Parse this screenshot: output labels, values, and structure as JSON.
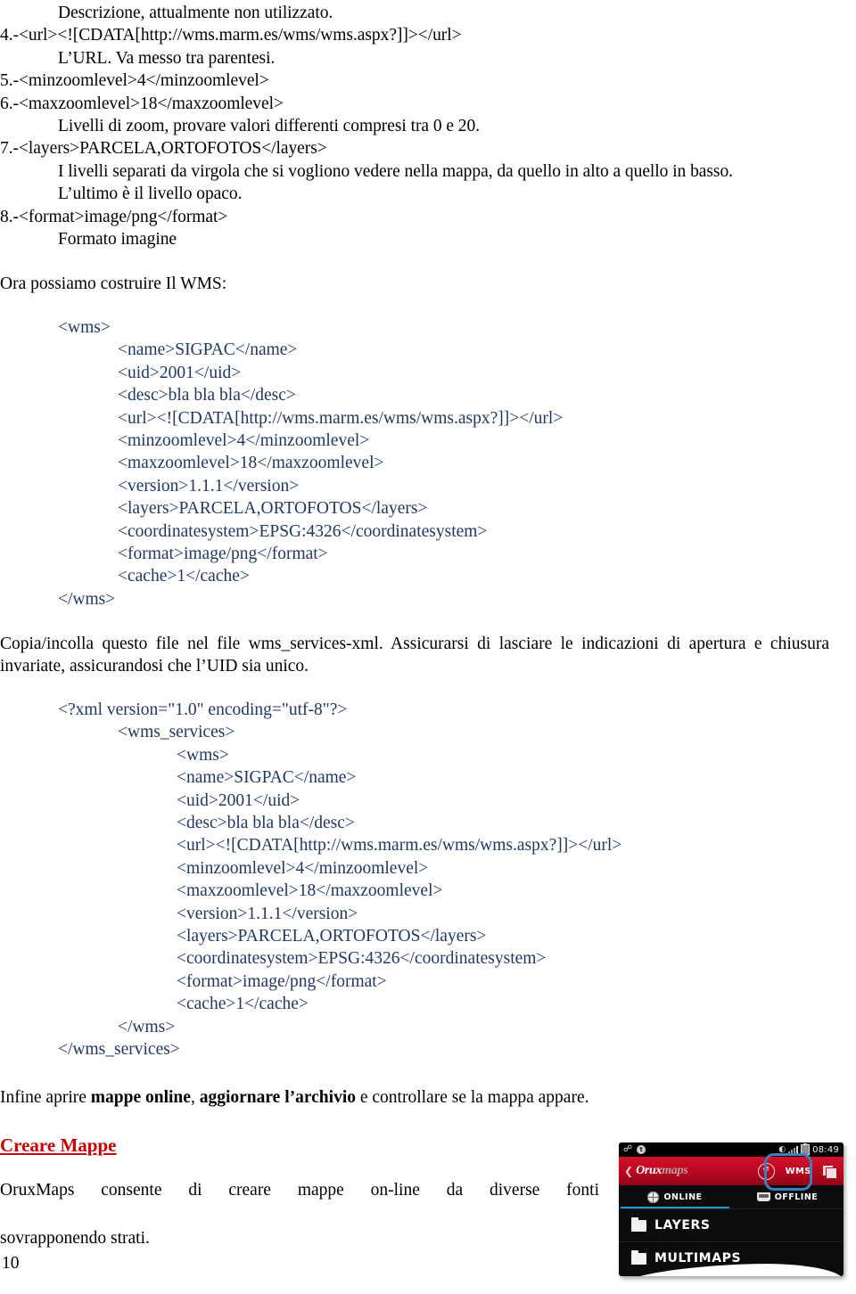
{
  "spec_list": [
    {
      "text": "Descrizione, attualmente non utilizzato.",
      "indent": true
    },
    {
      "text": "4.-<url><![CDATA[http://wms.marm.es/wms/wms.aspx?]]></url>",
      "indent": false
    },
    {
      "text": "L’URL. Va messo tra parentesi.",
      "indent": true
    },
    {
      "text": "5.-<minzoomlevel>4</minzoomlevel>",
      "indent": false
    },
    {
      "text": "6.-<maxzoomlevel>18</maxzoomlevel>",
      "indent": false
    },
    {
      "text": "Livelli di zoom, provare valori differenti compresi tra 0 e 20.",
      "indent": true
    },
    {
      "text": "7.-<layers>PARCELA,ORTOFOTOS</layers>",
      "indent": false
    },
    {
      "text": "I livelli separati da virgola che si vogliono vedere nella mappa, da quello in alto a quello in basso.",
      "indent": true
    },
    {
      "text": "L’ultimo è il livello opaco.",
      "indent": true
    },
    {
      "text": "8.-<format>image/png</format>",
      "indent": false
    },
    {
      "text": "Formato imagine",
      "indent": true
    }
  ],
  "lead_build": "Ora possiamo costruire Il WMS:",
  "code_block_1": {
    "color": "#1f3864",
    "lines": [
      {
        "text": "<wms>",
        "indent": 0
      },
      {
        "text": "<name>SIGPAC</name>",
        "indent": 1
      },
      {
        "text": "<uid>2001</uid>",
        "indent": 1
      },
      {
        "text": "<desc>bla bla bla</desc>",
        "indent": 1
      },
      {
        "text": "<url><![CDATA[http://wms.marm.es/wms/wms.aspx?]]></url>",
        "indent": 1
      },
      {
        "text": "<minzoomlevel>4</minzoomlevel>",
        "indent": 1
      },
      {
        "text": "<maxzoomlevel>18</maxzoomlevel>",
        "indent": 1
      },
      {
        "text": "<version>1.1.1</version>",
        "indent": 1
      },
      {
        "text": "<layers>PARCELA,ORTOFOTOS</layers>",
        "indent": 1
      },
      {
        "text": "<coordinatesystem>EPSG:4326</coordinatesystem>",
        "indent": 1
      },
      {
        "text": "<format>image/png</format>",
        "indent": 1
      },
      {
        "text": "<cache>1</cache>",
        "indent": 1
      },
      {
        "text": "</wms>",
        "indent": 0
      }
    ]
  },
  "para_paste": "Copia/incolla questo file nel file wms_services-xml. Assicurarsi di lasciare le indicazioni di apertura e chiusura invariate, assicurandosi che l’UID sia unico.",
  "code_block_2": {
    "color": "#1f3864",
    "lines": [
      {
        "text": "<?xml version=\"1.0\" encoding=\"utf-8\"?>",
        "indent": 0
      },
      {
        "text": "<wms_services>",
        "indent": 1
      },
      {
        "text": "<wms>",
        "indent": 2
      },
      {
        "text": "<name>SIGPAC</name>",
        "indent": 2
      },
      {
        "text": "<uid>2001</uid>",
        "indent": 2
      },
      {
        "text": "<desc>bla bla bla</desc>",
        "indent": 2
      },
      {
        "text": "<url><![CDATA[http://wms.marm.es/wms/wms.aspx?]]></url>",
        "indent": 2
      },
      {
        "text": "<minzoomlevel>4</minzoomlevel>",
        "indent": 2
      },
      {
        "text": "<maxzoomlevel>18</maxzoomlevel>",
        "indent": 2
      },
      {
        "text": "<version>1.1.1</version>",
        "indent": 2
      },
      {
        "text": "<layers>PARCELA,ORTOFOTOS</layers>",
        "indent": 2
      },
      {
        "text": "<coordinatesystem>EPSG:4326</coordinatesystem>",
        "indent": 2
      },
      {
        "text": "<format>image/png</format>",
        "indent": 2
      },
      {
        "text": "<cache>1</cache>",
        "indent": 2
      },
      {
        "text": "</wms>",
        "indent": 1
      },
      {
        "text": "</wms_services>",
        "indent": 0
      }
    ]
  },
  "para_final": {
    "prefix": "Infine aprire ",
    "bold_1": "mappe online",
    "middle": ", ",
    "bold_2": "aggiornare l’archivio",
    "suffix": " e controllare se la mappa appare."
  },
  "section_heading": {
    "label": "Creare Mappe",
    "color": "#cc0000"
  },
  "para_orux": {
    "line_1": "OruxMaps consente di creare mappe on-line da diverse fonti",
    "line_2": "sovrapponendo strati."
  },
  "page_number": "10",
  "orux_screenshot": {
    "status_bar": {
      "usb_icon": "usb-icon",
      "app_icon": "app-notification-icon",
      "wifi_icon": "wifi-icon",
      "signal_icon": "signal-bars-icon",
      "battery_icon": "battery-icon",
      "time": "08:49"
    },
    "action_bar": {
      "back_icon": "back-chevron-icon",
      "logo_strong": "Orux",
      "logo_light": "maps",
      "refresh_icon": "refresh-icon",
      "wms_label": "WMS",
      "layers_icon": "map-layers-icon",
      "highlight_color": "#3e7ec0",
      "bar_color": "#b8071f"
    },
    "tabs": [
      {
        "label": "ONLINE",
        "icon": "globe-icon",
        "active": true
      },
      {
        "label": "OFFLINE",
        "icon": "tray-icon",
        "active": false
      }
    ],
    "rows": [
      {
        "label": "LAYERS",
        "icon": "folder-icon"
      },
      {
        "label": "MULTIMAPS",
        "icon": "folder-icon"
      }
    ],
    "accent_color": "#1e9ad6"
  }
}
